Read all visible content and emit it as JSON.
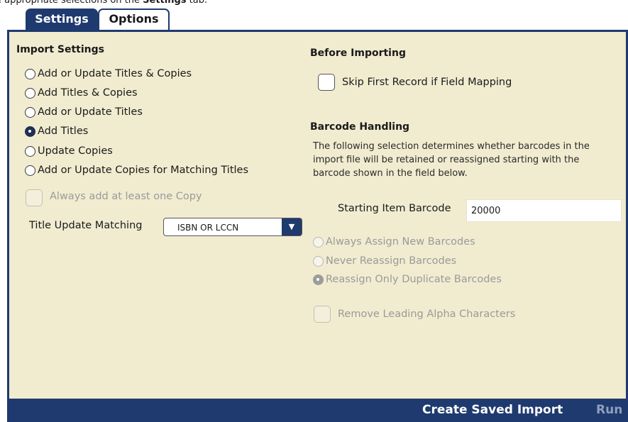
{
  "caption": {
    "prefix": "e appropriate selections on the ",
    "bold": "Settings",
    "suffix": " tab."
  },
  "tabs": [
    {
      "label": "Settings",
      "active": true
    },
    {
      "label": "Options",
      "active": false
    }
  ],
  "import_settings": {
    "heading": "Import Settings",
    "options": [
      {
        "label": "Add or Update Titles & Copies",
        "checked": false
      },
      {
        "label": "Add Titles & Copies",
        "checked": false
      },
      {
        "label": "Add or Update Titles",
        "checked": false
      },
      {
        "label": "Add Titles",
        "checked": true
      },
      {
        "label": "Update Copies",
        "checked": false
      },
      {
        "label": "Add or Update Copies for Matching Titles",
        "checked": false
      }
    ],
    "always_add_copy_label": "Always add at least one Copy",
    "title_update_matching_label": "Title Update Matching",
    "title_update_matching_value": "ISBN OR LCCN"
  },
  "before_importing": {
    "heading": "Before Importing",
    "skip_first_record_label": "Skip First Record if Field Mapping"
  },
  "barcode_handling": {
    "heading": "Barcode Handling",
    "description": "The following selection determines whether barcodes in the import file will be retained or reassigned starting with the barcode shown in the field below.",
    "starting_barcode_label": "Starting Item Barcode",
    "starting_barcode_value": "20000",
    "options": [
      {
        "label": "Always Assign New Barcodes",
        "checked": false
      },
      {
        "label": "Never Reassign Barcodes",
        "checked": false
      },
      {
        "label": "Reassign Only Duplicate Barcodes",
        "checked": true
      }
    ],
    "remove_alpha_label": "Remove Leading Alpha Characters"
  },
  "bottom_bar": {
    "create_saved_import": "Create Saved Import",
    "run": "Run"
  },
  "colors": {
    "navy": "#1f3a6e",
    "panel": "#f1ecd0"
  }
}
